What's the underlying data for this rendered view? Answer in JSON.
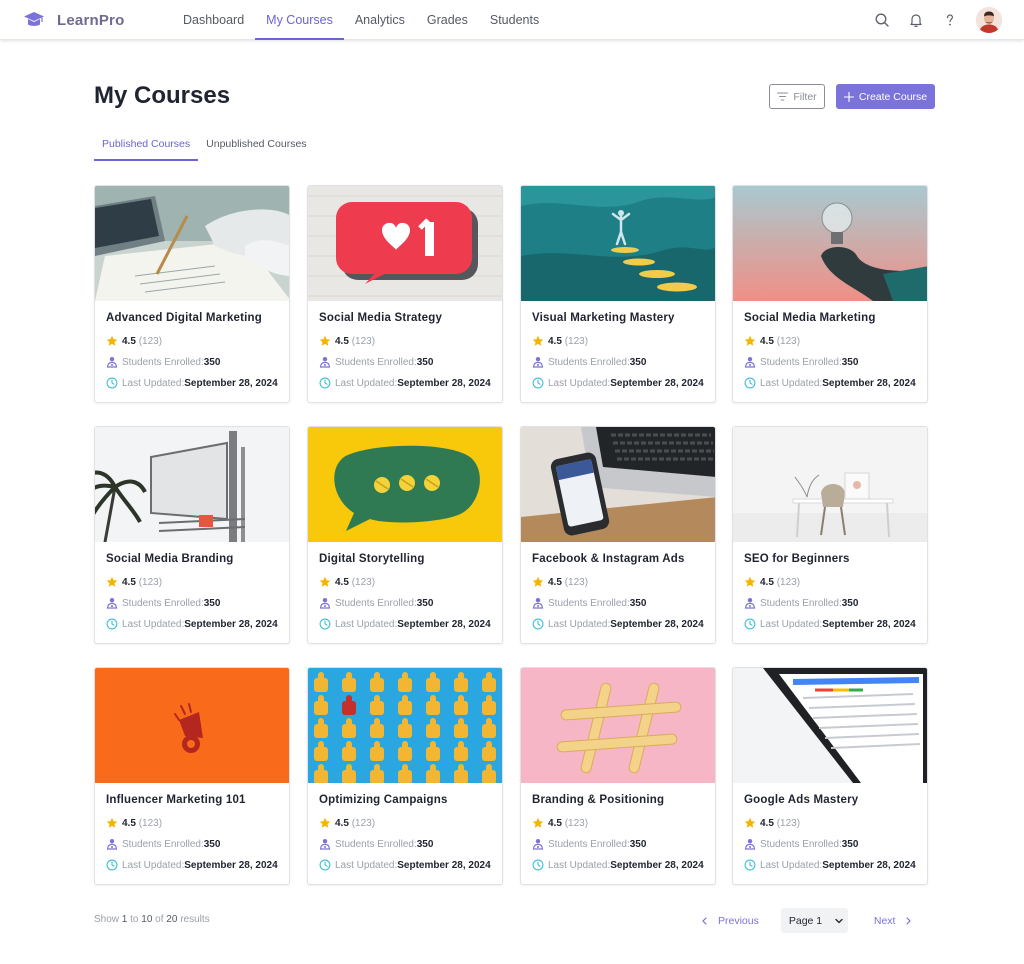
{
  "brand": {
    "name": "LearnPro",
    "icon": "graduation-cap-icon"
  },
  "nav": [
    "Dashboard",
    "My Courses",
    "Analytics",
    "Grades",
    "Students"
  ],
  "nav_active": "My Courses",
  "top_icons": [
    "search-icon",
    "bell-icon",
    "help-icon"
  ],
  "page": {
    "title": "My Courses",
    "filter_label": "Filter",
    "create_label": "Create Course"
  },
  "tabs": [
    "Published Courses",
    "Unpublished Courses"
  ],
  "tabs_active": "Published Courses",
  "colors": {
    "accent": "#7b73d9",
    "star": "#f4b400",
    "students_icon": "#7b73d9",
    "updated_icon": "#3cbfd6"
  },
  "courses": [
    {
      "title": "Advanced Digital Marketing",
      "rating": "4.5",
      "reviews": "(123)",
      "students_label": "Students Enrolled:",
      "students": "350",
      "updated_label": "Last Updated:",
      "updated": "September 28, 2024"
    },
    {
      "title": "Social Media Strategy",
      "rating": "4.5",
      "reviews": "(123)",
      "students_label": "Students Enrolled:",
      "students": "350",
      "updated_label": "Last Updated:",
      "updated": "September 28, 2024"
    },
    {
      "title": "Visual Marketing Mastery",
      "rating": "4.5",
      "reviews": "(123)",
      "students_label": "Students Enrolled:",
      "students": "350",
      "updated_label": "Last Updated:",
      "updated": "September 28, 2024"
    },
    {
      "title": "Social Media Marketing",
      "rating": "4.5",
      "reviews": "(123)",
      "students_label": "Students Enrolled:",
      "students": "350",
      "updated_label": "Last Updated:",
      "updated": "September 28, 2024"
    },
    {
      "title": "Social Media Branding",
      "rating": "4.5",
      "reviews": "(123)",
      "students_label": "Students Enrolled:",
      "students": "350",
      "updated_label": "Last Updated:",
      "updated": "September 28, 2024"
    },
    {
      "title": "Digital Storytelling",
      "rating": "4.5",
      "reviews": "(123)",
      "students_label": "Students Enrolled:",
      "students": "350",
      "updated_label": "Last Updated:",
      "updated": "September 28, 2024"
    },
    {
      "title": "Facebook & Instagram Ads",
      "rating": "4.5",
      "reviews": "(123)",
      "students_label": "Students Enrolled:",
      "students": "350",
      "updated_label": "Last Updated:",
      "updated": "September 28, 2024"
    },
    {
      "title": "SEO for Beginners",
      "rating": "4.5",
      "reviews": "(123)",
      "students_label": "Students Enrolled:",
      "students": "350",
      "updated_label": "Last Updated:",
      "updated": "September 28, 2024"
    },
    {
      "title": "Influencer Marketing 101",
      "rating": "4.5",
      "reviews": "(123)",
      "students_label": "Students Enrolled:",
      "students": "350",
      "updated_label": "Last Updated:",
      "updated": "September 28, 2024"
    },
    {
      "title": "Optimizing Campaigns",
      "rating": "4.5",
      "reviews": "(123)",
      "students_label": "Students Enrolled:",
      "students": "350",
      "updated_label": "Last Updated:",
      "updated": "September 28, 2024"
    },
    {
      "title": "Branding & Positioning",
      "rating": "4.5",
      "reviews": "(123)",
      "students_label": "Students Enrolled:",
      "students": "350",
      "updated_label": "Last Updated:",
      "updated": "September 28, 2024"
    },
    {
      "title": "Google Ads Mastery",
      "rating": "4.5",
      "reviews": "(123)",
      "students_label": "Students Enrolled:",
      "students": "350",
      "updated_label": "Last Updated:",
      "updated": "September 28, 2024"
    }
  ],
  "footer": {
    "show": "Show",
    "from": "1",
    "to_word": "to",
    "to": "10",
    "of_word": "of",
    "total": "20",
    "results_word": "results",
    "previous": "Previous",
    "page_select": "Page 1",
    "next": "Next"
  }
}
